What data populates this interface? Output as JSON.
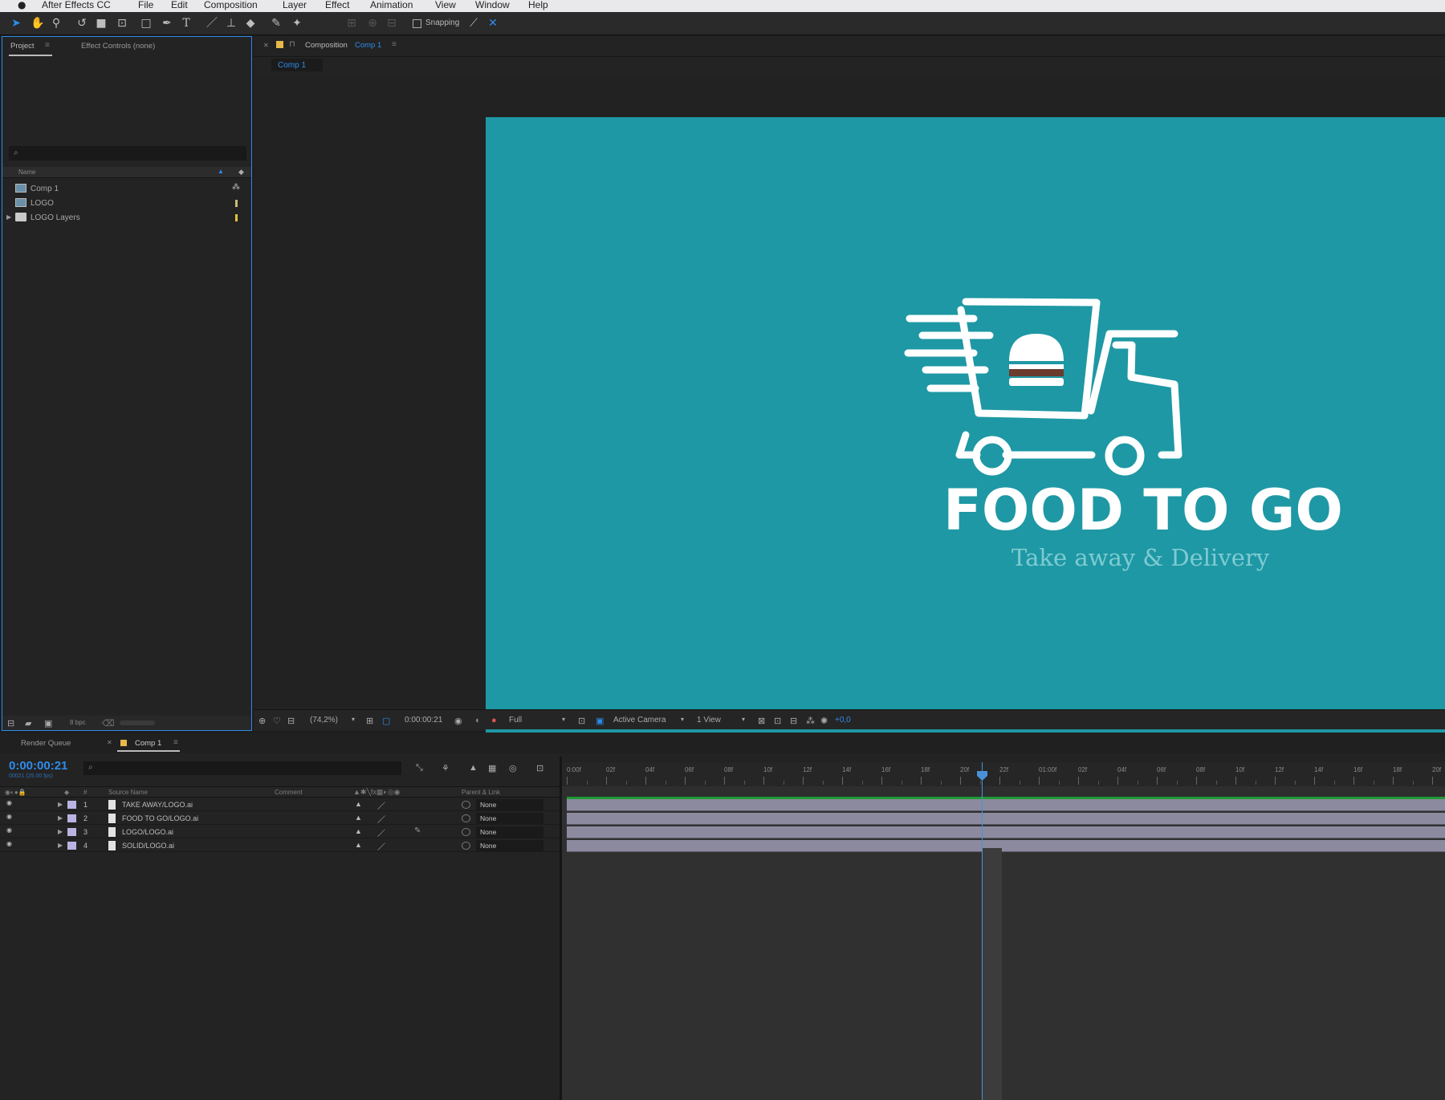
{
  "menubar": {
    "apple": "",
    "items": [
      "After Effects CC",
      "File",
      "Edit",
      "Composition",
      "Layer",
      "Effect",
      "Animation",
      "View",
      "Window",
      "Help"
    ]
  },
  "toolbar": {
    "snapping_label": "Snapping",
    "tools": [
      "selection-tool",
      "hand-tool",
      "zoom-tool",
      "rotate-tool",
      "camera-tool",
      "pan-behind-tool",
      "rectangle-tool",
      "pen-tool",
      "type-tool",
      "brush-tool",
      "clone-stamp-tool",
      "eraser-tool",
      "roto-brush-tool",
      "puppet-pin-tool"
    ]
  },
  "project_panel": {
    "tab_project": "Project",
    "tab_effect_controls": "Effect Controls (none)",
    "column_name": "Name",
    "items": [
      {
        "label": "Comp 1",
        "type": "composition"
      },
      {
        "label": "LOGO",
        "type": "composition"
      },
      {
        "label": "LOGO Layers",
        "type": "folder"
      }
    ],
    "bpc": "8 bpc"
  },
  "composition_panel": {
    "title_prefix": "Composition",
    "comp_name": "Comp 1",
    "sub_tab": "Comp 1",
    "footer": {
      "zoom": "(74,2%)",
      "timecode": "0:00:00:21",
      "resolution": "Full",
      "camera": "Active Camera",
      "views": "1 View",
      "offset": "+0,0"
    }
  },
  "artwork": {
    "title": "FOOD TO GO",
    "tagline": "Take away & Delivery",
    "bg_color": "#1e98a4",
    "line_color": "#ffffff",
    "patty_color": "#6b3b2e"
  },
  "timeline": {
    "tab_render_queue": "Render Queue",
    "tab_comp": "Comp 1",
    "timecode": "0:00:00:21",
    "fps": "00021 (25.00 fps)",
    "columns": {
      "source_name": "Source Name",
      "comment": "Comment",
      "parent": "Parent & Link",
      "hash": "#"
    },
    "layers": [
      {
        "num": "1",
        "name": "TAKE AWAY/LOGO.ai",
        "parent": "None"
      },
      {
        "num": "2",
        "name": "FOOD TO GO/LOGO.ai",
        "parent": "None"
      },
      {
        "num": "3",
        "name": "LOGO/LOGO.ai",
        "parent": "None"
      },
      {
        "num": "4",
        "name": "SOLID/LOGO.ai",
        "parent": "None"
      }
    ],
    "ruler_labels": [
      "0:00f",
      "02f",
      "04f",
      "06f",
      "08f",
      "10f",
      "12f",
      "14f",
      "16f",
      "18f",
      "20f",
      "22f",
      "01:00f",
      "02f",
      "04f",
      "06f",
      "08f",
      "10f",
      "12f",
      "14f",
      "16f",
      "18f",
      "20f"
    ],
    "work_area_color": "#1f9a35",
    "playhead_color": "#4a90d9"
  }
}
